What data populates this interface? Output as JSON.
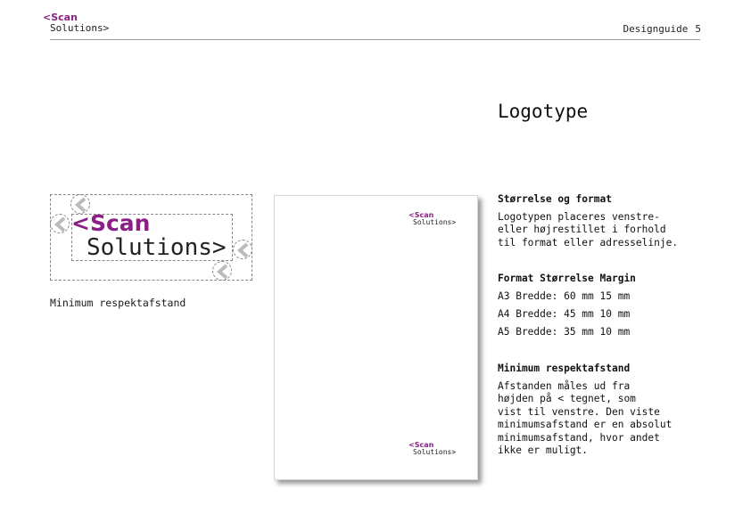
{
  "header": {
    "logo_line1": "<Scan",
    "logo_line2": "Solutions>",
    "section": "Designguide",
    "page_number": "5"
  },
  "title": "Logotype",
  "demo": {
    "logo_line1": "<Scan",
    "logo_line2": "Solutions>",
    "caption": "Minimum respektafstand"
  },
  "mockup": {
    "logo_top_line1": "<Scan",
    "logo_top_line2": "Solutions>",
    "logo_bottom_line1": "<Scan",
    "logo_bottom_line2": "Solutions>"
  },
  "size_section": {
    "heading": "Størrelse og format",
    "body": "Logotypen placeres venstre-\neller højrestillet i forhold\ntil format eller adresselinje."
  },
  "format_table": {
    "header": "Format Størrelse Margin",
    "rows": [
      "A3 Bredde: 60 mm 15 mm",
      "A4 Bredde: 45 mm 10 mm",
      "A5 Bredde: 35 mm 10 mm"
    ]
  },
  "min_section": {
    "heading": "Minimum respektafstand",
    "body": "Afstanden måles ud fra\nhøjden på < tegnet, som\nvist til venstre. Den viste\nminimumsafstand er en absolut\nminimumsafstand, hvor andet\nikke er muligt."
  },
  "colors": {
    "brand": "#8b1f88",
    "text": "#1a1a1a",
    "rule": "#999999"
  }
}
